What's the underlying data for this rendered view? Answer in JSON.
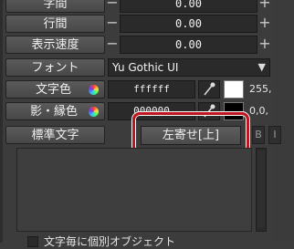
{
  "rows": {
    "char_spacing": {
      "label": "字間",
      "value": "0.00"
    },
    "line_spacing": {
      "label": "行間",
      "value": "0.00"
    },
    "display_speed": {
      "label": "表示速度",
      "value": "0.00"
    }
  },
  "font": {
    "label": "フォント",
    "value": "Yu Gothic UI"
  },
  "text_color": {
    "label": "文字色",
    "hex": "ffffff",
    "rgb": "255,",
    "swatch": "#ffffff"
  },
  "shadow_color": {
    "label": "影・縁色",
    "hex": "000000",
    "rgb": "0,0,",
    "swatch": "#000000"
  },
  "standard_text": {
    "label": "標準文字",
    "align_button": "左寄せ[上]",
    "bold": "B",
    "italic": "I"
  },
  "bottom": {
    "label": "文字毎に個別オブジェクト"
  },
  "colors": {
    "highlight": "#c0141e",
    "panel": "#3c3c3c"
  }
}
